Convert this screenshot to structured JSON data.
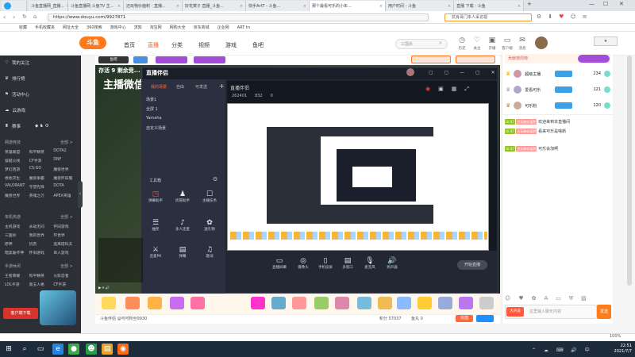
{
  "tabs": [
    {
      "label": "斗鱼直播网_直播...",
      "active": false
    },
    {
      "label": "斗鱼直播网 斗鱼TV 主...",
      "active": false
    },
    {
      "label": "还玩物价面积 - 直播...",
      "active": false
    },
    {
      "label": "好花菜子 直播_斗鱼...",
      "active": false
    },
    {
      "label": "快手ArtT - 斗鱼...",
      "active": false
    },
    {
      "label": "那个最看可乐的小年...",
      "active": true
    },
    {
      "label": "用户时间 - 斗鱼",
      "active": false
    },
    {
      "label": "直播 下载 - 斗鱼",
      "active": false
    }
  ],
  "url": "https://www.douyu.com/9927871",
  "browser_search_placeholder": "抗肖哥门本人采访视",
  "bookmarks": [
    "收藏",
    "手机收藏夹",
    "网址大全",
    "360搜索",
    "游戏中心",
    "求知",
    "淘宝网",
    "网购大全",
    "京东商城",
    "企业网",
    "ART tn"
  ],
  "site": {
    "logo": "斗鱼",
    "nav": [
      "首页",
      "直播",
      "分类",
      "视频",
      "游戏",
      "鱼吧"
    ],
    "nav_active": "直播",
    "search_placeholder": "三国杀",
    "header_icons": [
      "历史",
      "关注",
      "开播",
      "客户端",
      "消息"
    ]
  },
  "sidebar": {
    "items": [
      "我的关注",
      "排行榜",
      "活动中心",
      "云游戏",
      "赛事"
    ],
    "sections": [
      {
        "title": "网游竞技",
        "more": "全部 >",
        "items": [
          "英雄联盟",
          "和平精英",
          "DOTA2",
          "穿越火线",
          "CF手游",
          "DNF",
          "梦幻西游",
          "CS:GO",
          "魔兽世界",
          "绝地求生",
          "魔兽争霸",
          "魔兽怀旧服",
          "VALORANT",
          "守望先锋",
          "DOTA",
          "魔兽世界",
          "英魂之刃",
          "APEX英雄"
        ]
      },
      {
        "title": "单机热游",
        "more": "全部 >",
        "items": [
          "主机游戏",
          "永劫无间",
          "怀旧游戏",
          "三国杀",
          "我的世界",
          "环世界",
          "原神",
          "饥荒",
          "逃离塔科夫",
          "暗黑破坏神",
          "怀旧游戏",
          "单人游戏"
        ]
      },
      {
        "title": "手游休闲",
        "more": "全部 >",
        "items": [
          "王者荣耀",
          "和平精英",
          "火影忍者",
          "LOL手游",
          "第五人格",
          "CF手游"
        ]
      }
    ],
    "promo": "客户端下载"
  },
  "stream": {
    "overlay_title": "存活 9  剩余竞...",
    "overlay_big": "主播微信",
    "room_tag": "鱼吧",
    "app_logo": "直播伴侣",
    "app_tabs": [
      "我的场景",
      "自由",
      "可发送"
    ],
    "scene_rows": [
      "场景1",
      "全屏 1",
      "Yamaha",
      "自定义场景"
    ],
    "tool_section": "工具箱",
    "tools": [
      "弹幕助手",
      "房管助手",
      "主播任务",
      "抽奖",
      "多人连麦",
      "送礼物",
      "连麦PK",
      "弹幕",
      "歌词",
      "更多"
    ],
    "capture_title": "直播伴侣",
    "capture_counts": [
      "262401",
      "832",
      "0"
    ],
    "bottom_buttons": [
      "直播屏幕",
      "摄像头",
      "手机投屏",
      "多窗口",
      "麦克风",
      "扬声器"
    ],
    "start_btn": "开始直播"
  },
  "gifts": [
    "鱼丸",
    "荧光棒",
    "办卡",
    "赞",
    "飞机",
    "火箭",
    "超级火箭",
    "嘉年华"
  ],
  "bottom_strip": {
    "left": "斗鱼伴侣 @可可粉丝9930",
    "points": "积分 57037",
    "yuwan": "鱼丸 0",
    "recharge": "充值"
  },
  "right_panel": {
    "header": "贡献榜周榜",
    "follow_btn": "+关注",
    "ranks": [
      {
        "name": "超级主播",
        "score": "234"
      },
      {
        "name": "爱看可乐",
        "score": "121"
      },
      {
        "name": "可乐粉",
        "score": "120"
      }
    ],
    "chat": [
      {
        "lv": "LV 47",
        "badge": "还玩物价面积",
        "text": "欢迎来到本直播间"
      },
      {
        "lv": "LV 47",
        "badge": "还玩物价面积",
        "text": "看来可乐是啥新"
      },
      {
        "lv": "LV 47",
        "badge": "还玩物价面积",
        "text": "可乐会加啊"
      }
    ],
    "input_placeholder": "这里输入聊天内容",
    "send": "发送",
    "barrage": "大声说"
  },
  "status": {
    "zoom": "100%"
  },
  "taskbar": {
    "time": "22:51",
    "date": "2021/7/7"
  }
}
